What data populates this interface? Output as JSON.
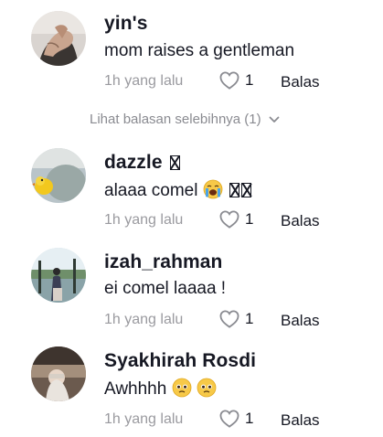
{
  "comments": [
    {
      "username": "yin's",
      "text": "mom raises a gentleman",
      "time": "1h yang lalu",
      "likes": "1",
      "reply_label": "Balas",
      "avatar_icon": "avatar-hand-photo"
    },
    {
      "username": "dazzle",
      "text": "alaaa comel",
      "time": "1h yang lalu",
      "likes": "1",
      "reply_label": "Balas",
      "avatar_icon": "avatar-plush-photo",
      "text_emoji": "loudly-crying-face-emoji"
    },
    {
      "username": "izah_rahman",
      "text": "ei comel laaaa !",
      "time": "1h yang lalu",
      "likes": "1",
      "reply_label": "Balas",
      "avatar_icon": "avatar-person-outdoor-photo"
    },
    {
      "username": "Syakhirah Rosdi",
      "text": "Awhhhh",
      "time": "1h yang lalu",
      "likes": "1",
      "reply_label": "Balas",
      "avatar_icon": "avatar-person-hijab-photo",
      "text_emoji": "pleading-face-emoji"
    }
  ],
  "more_replies": {
    "label": "Lihat balasan selebihnya (1)",
    "icon": "chevron-down-icon"
  },
  "colors": {
    "text": "#161823",
    "muted": "#9a9a9f",
    "heart_outline": "#8a8b91"
  }
}
